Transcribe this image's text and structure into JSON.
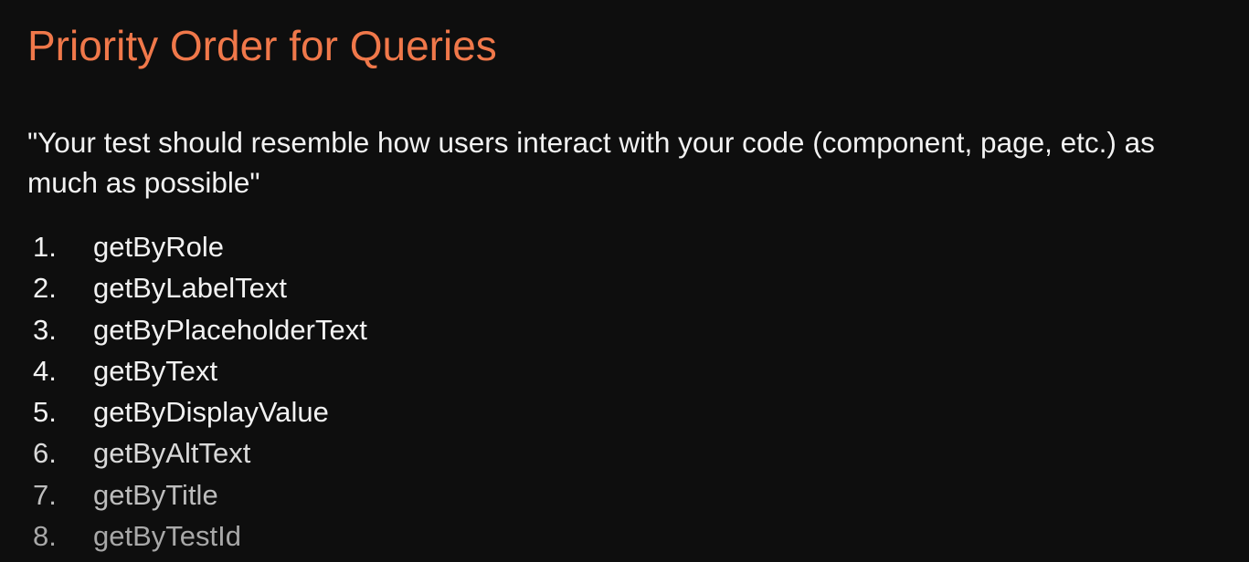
{
  "slide": {
    "title": "Priority Order for Queries",
    "quote": "\"Your test should resemble how users interact with your code (component, page, etc.) as much as possible\"",
    "queries": [
      {
        "number": "1.",
        "label": "getByRole"
      },
      {
        "number": "2.",
        "label": "getByLabelText"
      },
      {
        "number": "3.",
        "label": "getByPlaceholderText"
      },
      {
        "number": "4.",
        "label": "getByText"
      },
      {
        "number": "5.",
        "label": "getByDisplayValue"
      },
      {
        "number": "6.",
        "label": "getByAltText"
      },
      {
        "number": "7.",
        "label": "getByTitle"
      },
      {
        "number": "8.",
        "label": "getByTestId"
      }
    ]
  },
  "colors": {
    "background": "#0e0e0e",
    "title": "#f0784a",
    "text": "#f2f2f2"
  }
}
